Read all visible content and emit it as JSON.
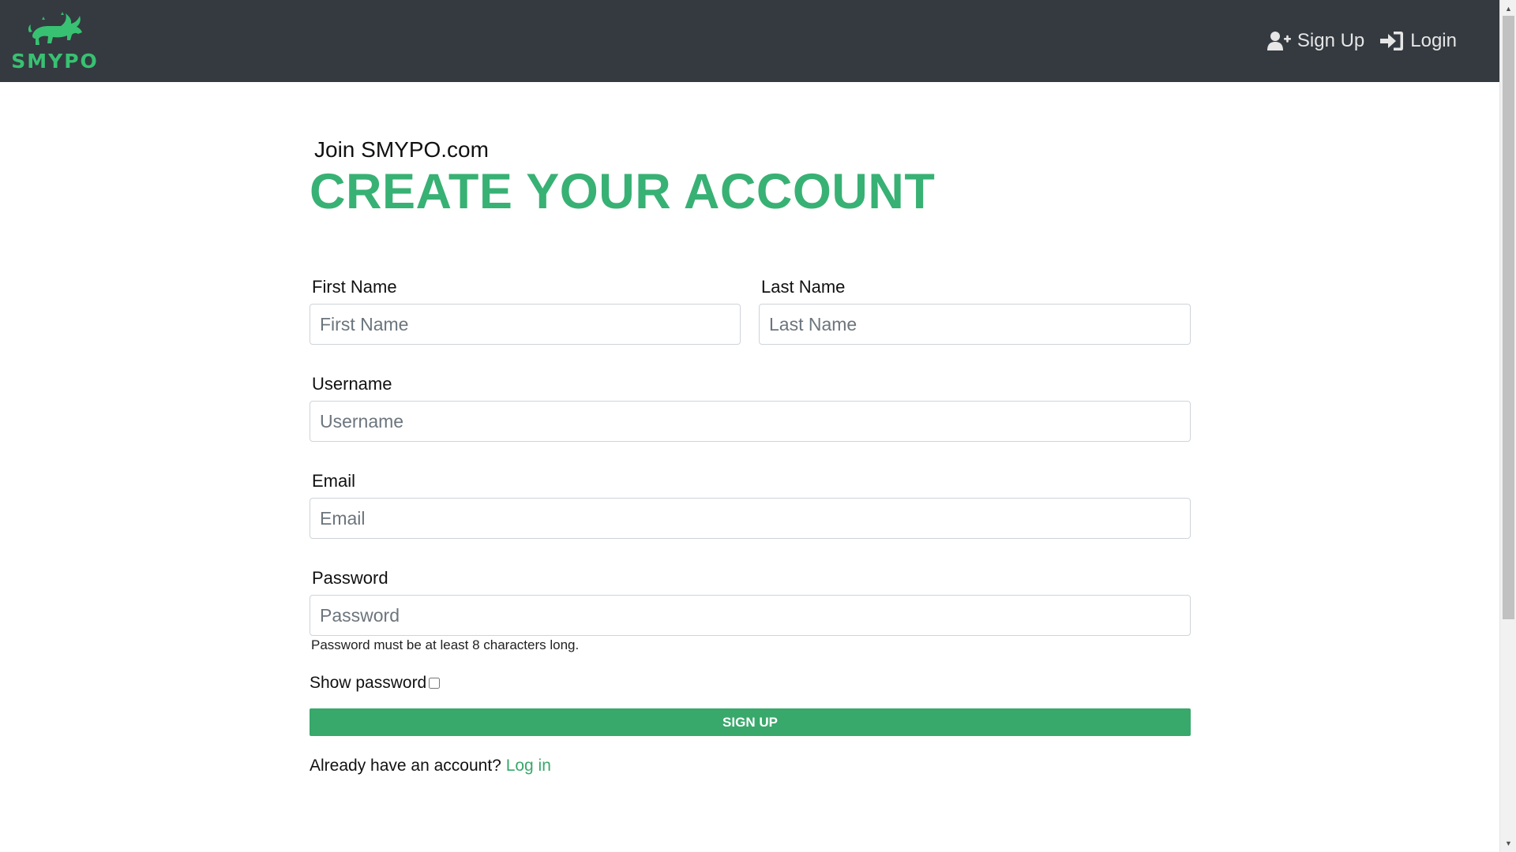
{
  "navbar": {
    "brand": "SMYPO",
    "links": [
      {
        "label": "Sign Up",
        "icon": "user-plus-icon"
      },
      {
        "label": "Login",
        "icon": "sign-in-icon"
      }
    ]
  },
  "header": {
    "kicker": "Join SMYPO.com",
    "title": "CREATE YOUR ACCOUNT"
  },
  "form": {
    "first_name": {
      "label": "First Name",
      "placeholder": "First Name"
    },
    "last_name": {
      "label": "Last Name",
      "placeholder": "Last Name"
    },
    "username": {
      "label": "Username",
      "placeholder": "Username"
    },
    "email": {
      "label": "Email",
      "placeholder": "Email"
    },
    "password": {
      "label": "Password",
      "placeholder": "Password",
      "helper": "Password must be at least 8 characters long."
    },
    "show_password_label": "Show password",
    "show_password_checked": false,
    "submit_label": "SIGN UP",
    "login_prompt": "Already have an account?",
    "login_link": "Log in"
  },
  "colors": {
    "navbar_bg": "#343a40",
    "brand_green": "#38c172",
    "accent_green": "#38a86b",
    "heading_green": "#38b174"
  }
}
